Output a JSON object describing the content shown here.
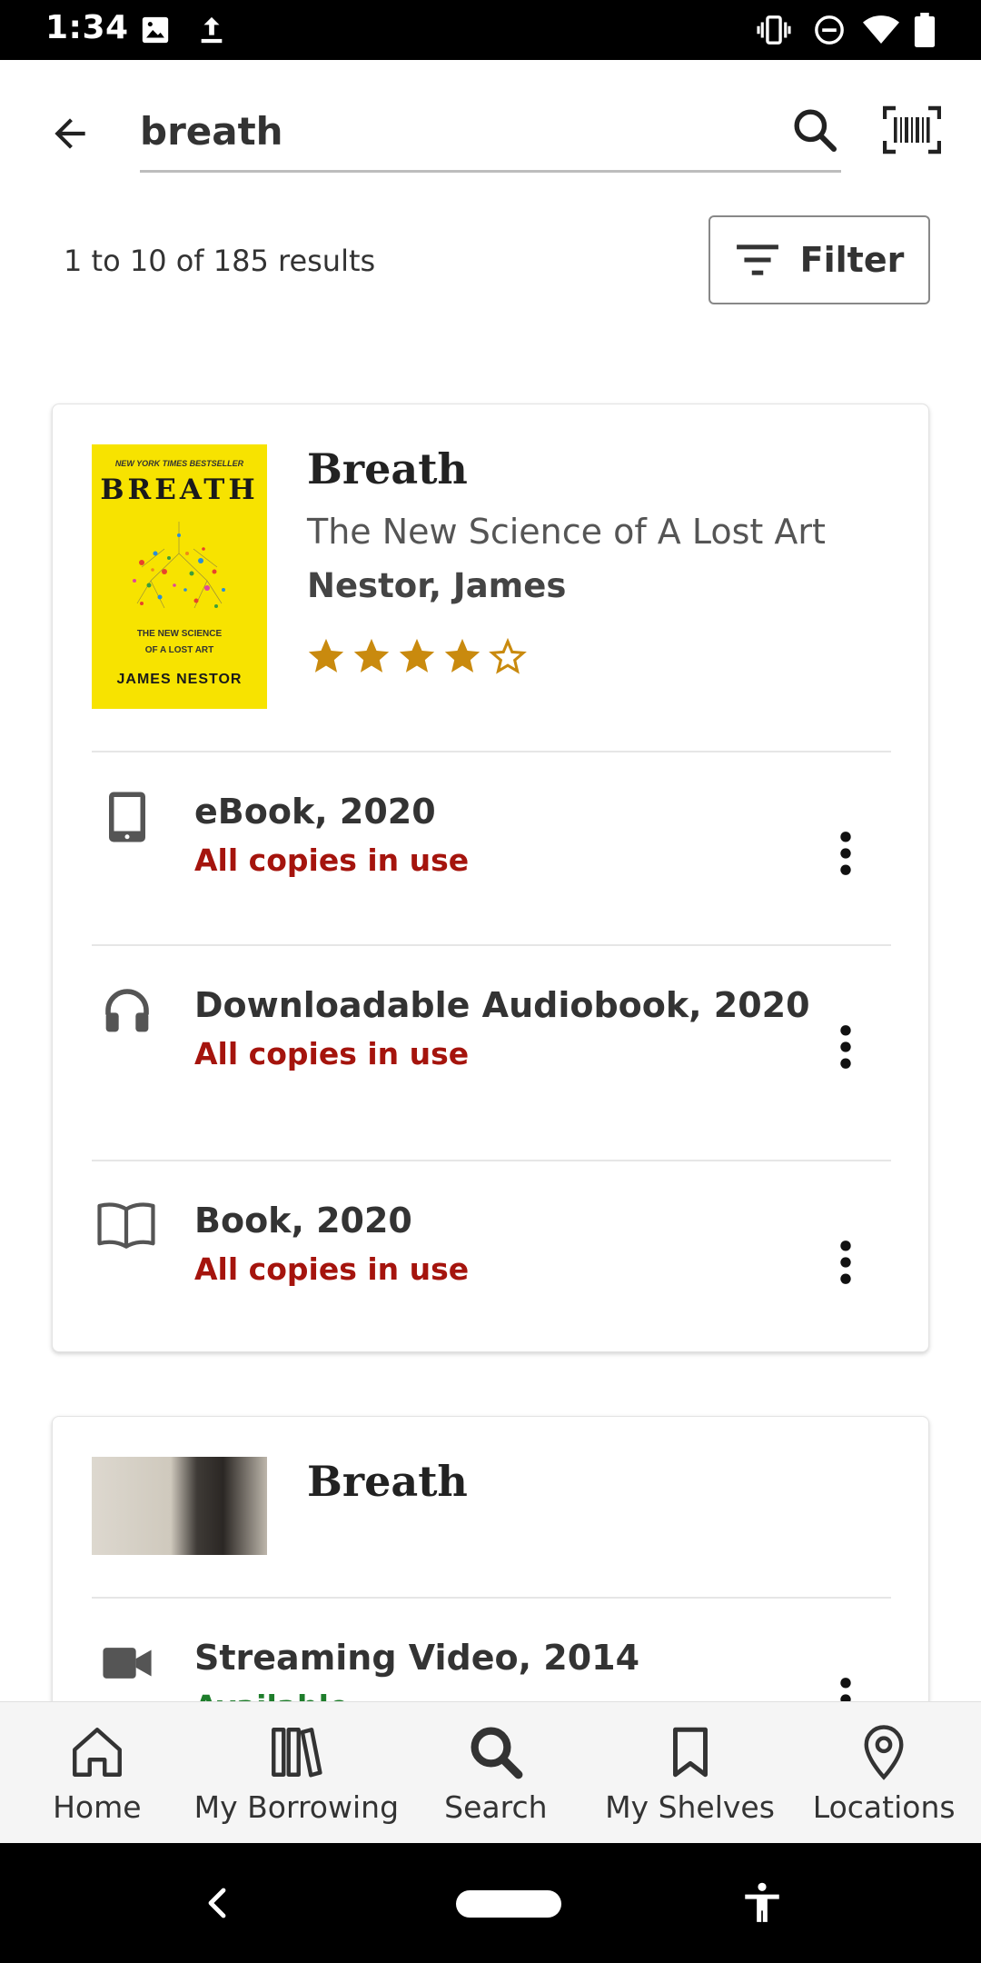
{
  "status_bar": {
    "time": "1:34"
  },
  "search": {
    "query": "breath"
  },
  "results": {
    "count_text": "1 to 10 of 185 results",
    "filter_label": "Filter"
  },
  "items": [
    {
      "title": "Breath",
      "subtitle": "The New Science of A Lost Art",
      "author": "Nestor, James",
      "rating": 4,
      "rating_max": 5,
      "cover": {
        "tag": "NEW YORK TIMES BESTSELLER",
        "title": "BREATH",
        "subtitle_line1": "THE NEW SCIENCE",
        "subtitle_line2": "OF A LOST ART",
        "author": "JAMES NESTOR"
      },
      "formats": [
        {
          "name": "eBook, 2020",
          "status": "All copies in use",
          "icon": "tablet-icon"
        },
        {
          "name": "Downloadable Audiobook, 2020",
          "status": "All copies in use",
          "icon": "headphones-icon"
        },
        {
          "name": "Book, 2020",
          "status": "All copies in use",
          "icon": "open-book-icon"
        }
      ]
    },
    {
      "title": "Breath",
      "formats": [
        {
          "name": "Streaming Video, 2014",
          "status": "Available",
          "icon": "video-camera-icon"
        }
      ]
    }
  ],
  "bottom_nav": [
    {
      "label": "Home",
      "icon": "home-icon"
    },
    {
      "label": "My Borrowing",
      "icon": "books-icon"
    },
    {
      "label": "Search",
      "icon": "search-icon"
    },
    {
      "label": "My Shelves",
      "icon": "bookmark-icon"
    },
    {
      "label": "Locations",
      "icon": "location-pin-icon"
    }
  ],
  "colors": {
    "unavailable": "#a5140d",
    "available": "#1e7d2b",
    "star": "#c98a0e"
  }
}
